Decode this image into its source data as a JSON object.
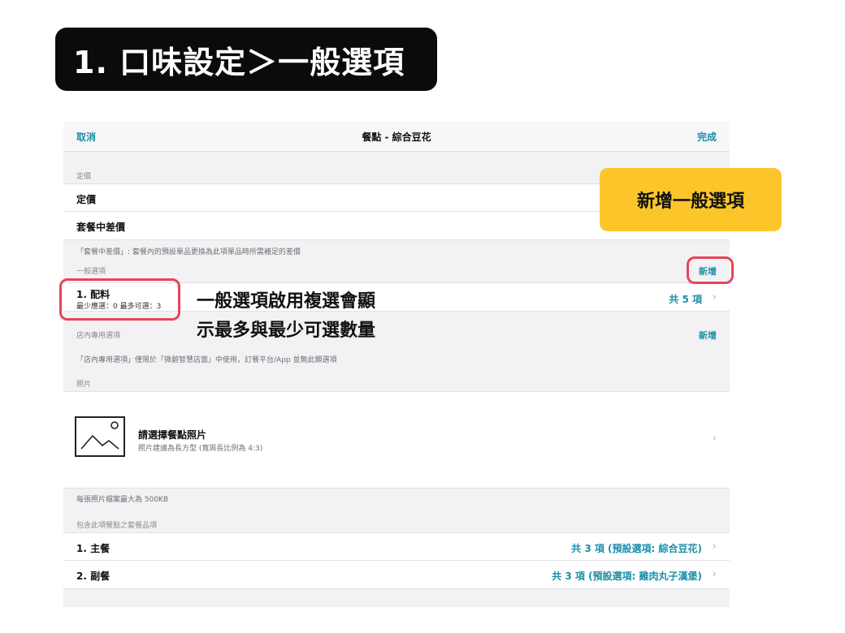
{
  "banner": {
    "title": "1. 口味設定＞一般選項"
  },
  "navbar": {
    "cancel": "取消",
    "title": "餐點 - 綜合豆花",
    "done": "完成"
  },
  "price_section": {
    "label": "定價",
    "rows": [
      {
        "label": "定價"
      },
      {
        "label": "套餐中差價"
      }
    ],
    "note": "「套餐中差價」: 套餐內的預設單品更換為此項單品時所需補足的差價"
  },
  "general_options": {
    "label": "一般選項",
    "add": "新增",
    "item": {
      "title": "1. 配料",
      "sub": "最少應選：0 最多可選：3",
      "value": "共 5 項"
    }
  },
  "store_options": {
    "label": "店內專用選項",
    "add": "新增",
    "note": "「店內專用選項」僅限於「微碧智慧店面」中使用，訂餐平台/App 並無此類選項"
  },
  "photo": {
    "label": "照片",
    "title": "請選擇餐點照片",
    "sub": "照片建議為長方型 (寬與長比例為 4:3)",
    "note": "每張照片檔案最大為 500KB"
  },
  "combo": {
    "label": "包含此項餐點之套餐品項",
    "items": [
      {
        "label": "1. 主餐",
        "value": "共 3 項 (預設選項: 綜合豆花)"
      },
      {
        "label": "2. 副餐",
        "value": "共 3 項 (預設選項: 雞肉丸子漢堡)"
      }
    ]
  },
  "annotations": {
    "add_callout": "新增一般選項",
    "multi_select_line1": "一般選項啟用複選會顯",
    "multi_select_line2": "示最多與最少可選數量"
  },
  "colors": {
    "accent": "#1a8fa8",
    "highlight": "#e8445a",
    "callout": "#fcc62a",
    "banner": "#0b0b0b"
  }
}
